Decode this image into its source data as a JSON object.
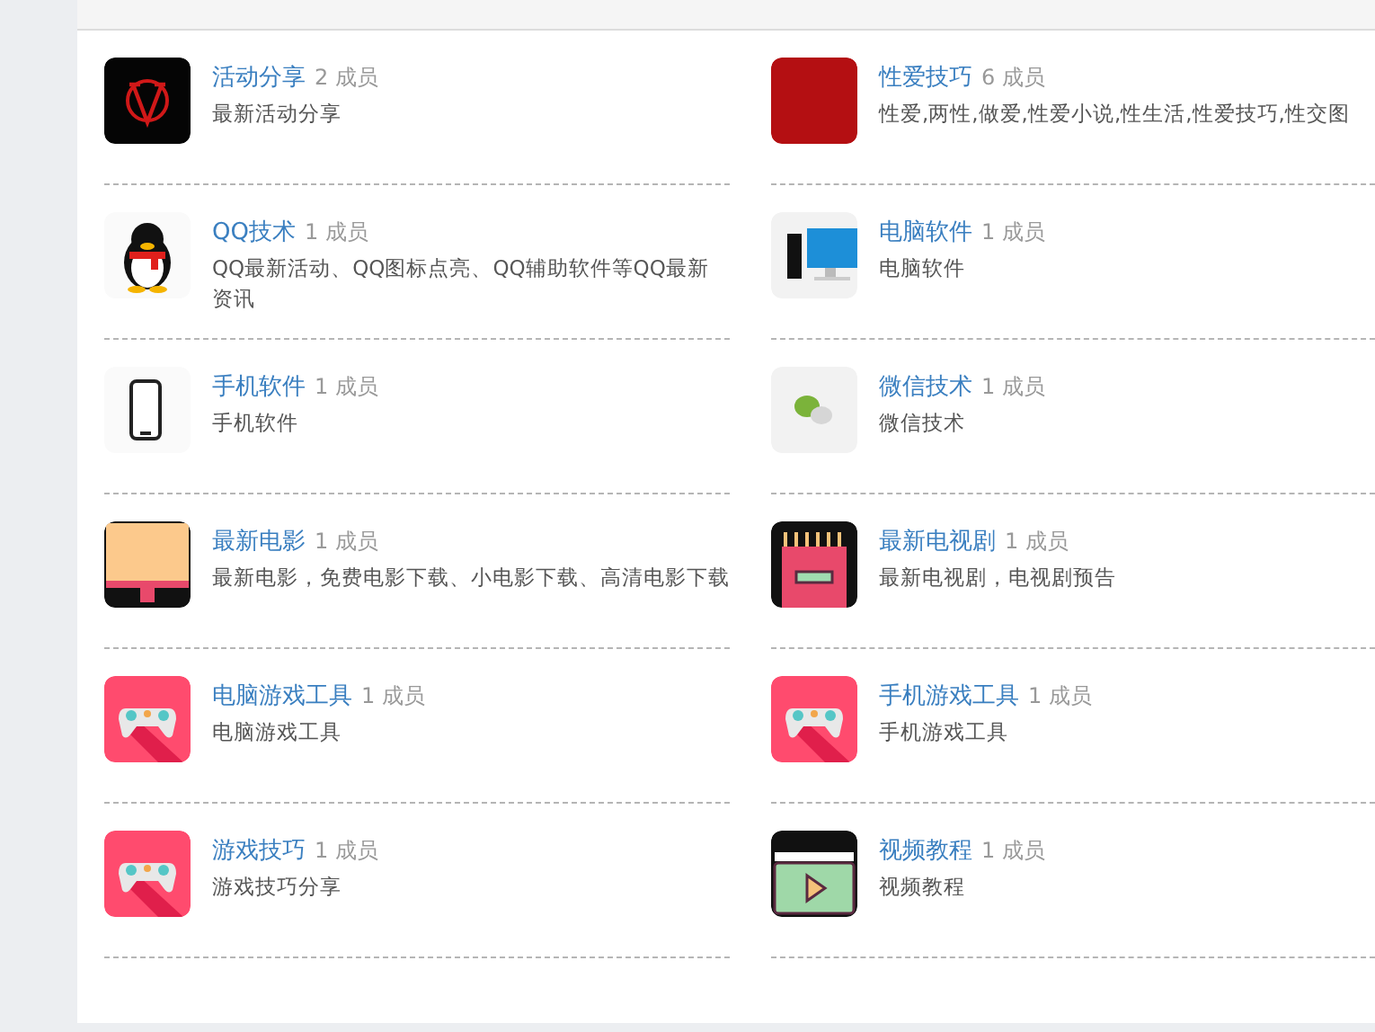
{
  "groups": [
    {
      "name": "活动分享",
      "members": "2 成员",
      "description": "最新活动分享",
      "kind": "v-logo"
    },
    {
      "name": "性爱技巧",
      "members": "6 成员",
      "description": "性爱,两性,做爱,性爱小说,性生活,性爱技巧,性交图",
      "kind": "photo"
    },
    {
      "name": "QQ技术",
      "members": "1 成员",
      "description": "QQ最新活动、QQ图标点亮、QQ辅助软件等QQ最新资讯",
      "kind": "penguin"
    },
    {
      "name": "电脑软件",
      "members": "1 成员",
      "description": "电脑软件",
      "kind": "computer"
    },
    {
      "name": "手机软件",
      "members": "1 成员",
      "description": "手机软件",
      "kind": "phone"
    },
    {
      "name": "微信技术",
      "members": "1 成员",
      "description": "微信技术",
      "kind": "chat"
    },
    {
      "name": "最新电影",
      "members": "1 成员",
      "description": "最新电影，免费电影下载、小电影下载、高清电影下载",
      "kind": "monitor"
    },
    {
      "name": "最新电视剧",
      "members": "1 成员",
      "description": "最新电视剧，电视剧预告",
      "kind": "popcorn"
    },
    {
      "name": "电脑游戏工具",
      "members": "1 成员",
      "description": "电脑游戏工具",
      "kind": "gamepad"
    },
    {
      "name": "手机游戏工具",
      "members": "1 成员",
      "description": "手机游戏工具",
      "kind": "gamepad"
    },
    {
      "name": "游戏技巧",
      "members": "1 成员",
      "description": "游戏技巧分享",
      "kind": "gamepad"
    },
    {
      "name": "视频教程",
      "members": "1 成员",
      "description": "视频教程",
      "kind": "film"
    }
  ]
}
